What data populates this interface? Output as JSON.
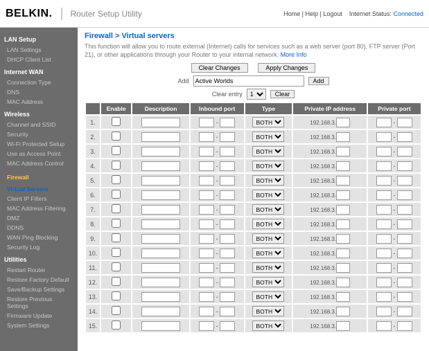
{
  "brand": "BELKIN.",
  "subtitle": "Router Setup Utility",
  "toplinks": [
    "Home",
    "Help",
    "Logout"
  ],
  "status_label": "Internet Status:",
  "status_value": "Connected",
  "breadcrumb": "Firewall > Virtual servers",
  "intro": "This function will allow you to route external (Internet) calls for services such as a web server (port 80), FTP server (Port 21), or other applications through your Router to your internal network.",
  "more": "More Info",
  "btn_clear_changes": "Clear Changes",
  "btn_apply": "Apply Changes",
  "add_label": "Add",
  "add_value": "Active Worlds",
  "btn_add": "Add",
  "clear_label": "Clear entry",
  "clear_value": "1",
  "btn_clear": "Clear",
  "ip_prefix": "192.168.3.",
  "type_opt": "BOTH",
  "cols": [
    "Enable",
    "Description",
    "Inbound port",
    "Type",
    "Private IP address",
    "Private port"
  ],
  "rowcount": 15,
  "sidebar": [
    {
      "hd": "LAN Setup",
      "items": [
        "LAN Settings",
        "DHCP Client List"
      ]
    },
    {
      "hd": "Internet WAN",
      "items": [
        "Connection Type",
        "DNS",
        "MAC Address"
      ]
    },
    {
      "hd": "Wireless",
      "items": [
        "Channel and SSID",
        "Security",
        "Wi-Fi Protected Setup",
        "Use as Access Point",
        "MAC Address Control"
      ]
    },
    {
      "hd": "Firewall",
      "active": true,
      "items": [
        "Virtual Servers",
        "Client IP Filters",
        "MAC Address Filtering",
        "DMZ",
        "DDNS",
        "WAN Ping Blocking",
        "Security Log"
      ],
      "sel": 0
    },
    {
      "hd": "Utilities",
      "items": [
        "Restart Router",
        "Restore Factory Default",
        "Save/Backup Settings",
        "Restore Previous Settings",
        "Firmware Update",
        "System Settings"
      ]
    }
  ]
}
